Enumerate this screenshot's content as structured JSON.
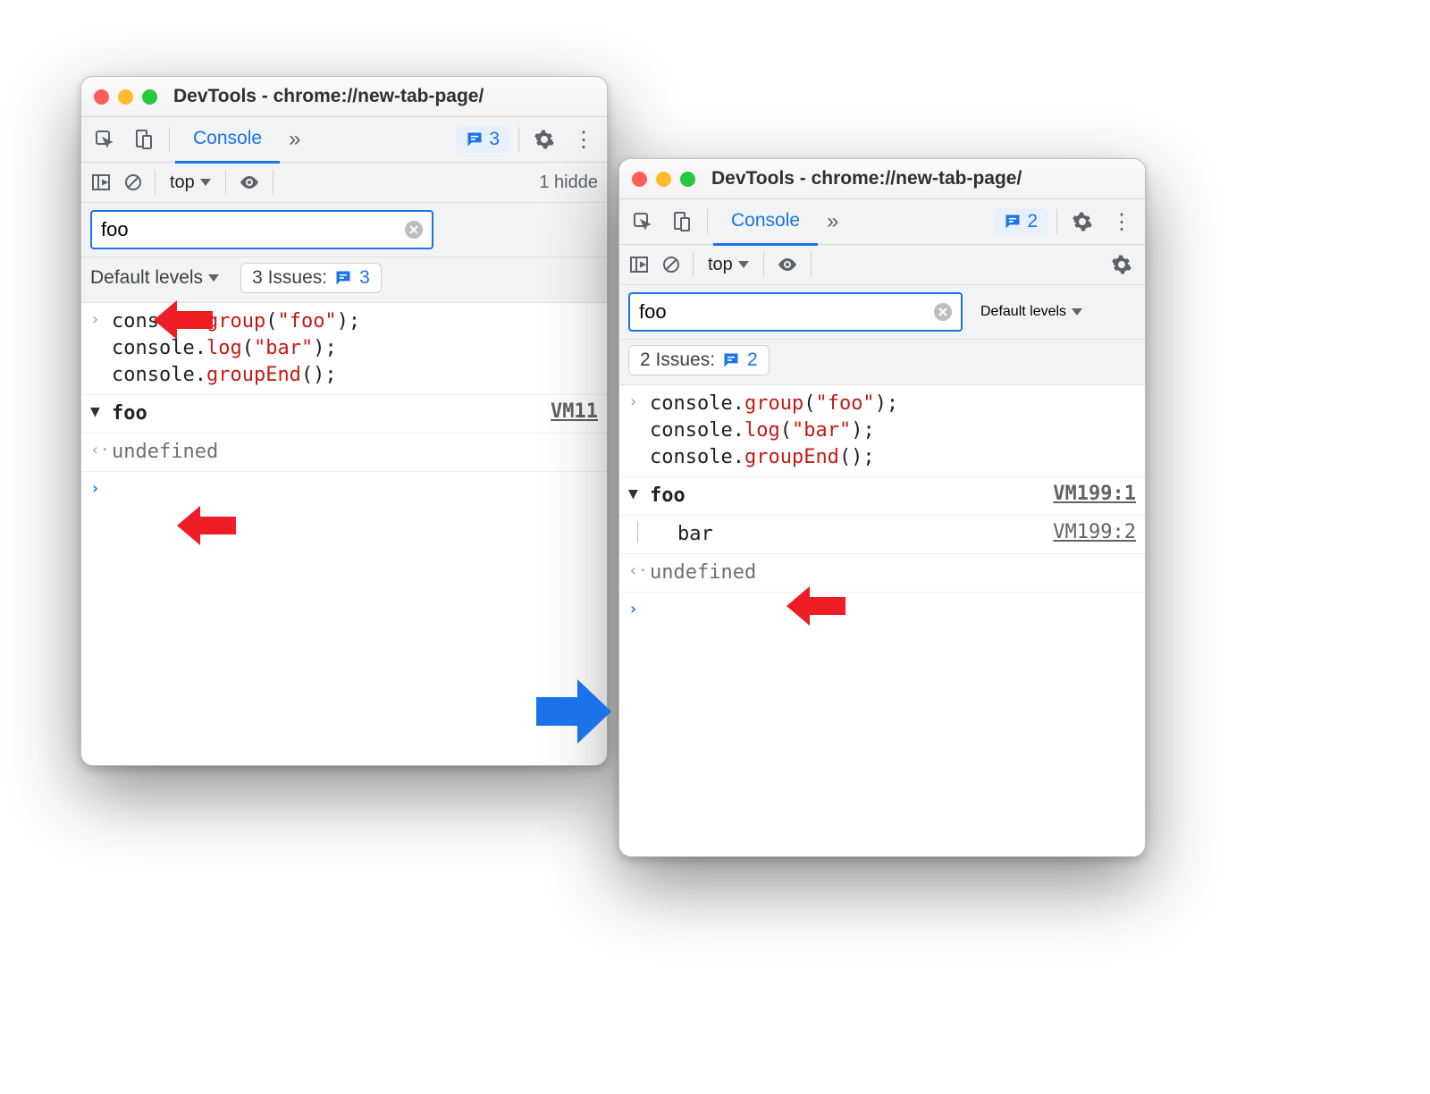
{
  "leftWindow": {
    "title": "DevTools - chrome://new-tab-page/",
    "tab": "Console",
    "issueBadge": "3",
    "context": "top",
    "hidden": "1 hidde",
    "filterValue": "foo",
    "levels": "Default levels",
    "issuesChip": {
      "label": "3 Issues:",
      "count": "3"
    },
    "codeInput": "console.group(\"foo\");\nconsole.log(\"bar\");\nconsole.groupEnd();",
    "groupName": "foo",
    "groupSrc": "VM11",
    "undefined": "undefined"
  },
  "rightWindow": {
    "title": "DevTools - chrome://new-tab-page/",
    "tab": "Console",
    "issueBadge": "2",
    "context": "top",
    "filterValue": "foo",
    "levels": "Default levels",
    "issuesChip": {
      "label": "2 Issues:",
      "count": "2"
    },
    "codeInput": "console.group(\"foo\");\nconsole.log(\"bar\");\nconsole.groupEnd();",
    "groupName": "foo",
    "groupSrc": "VM199:1",
    "barText": "bar",
    "barSrc": "VM199:2",
    "undefined": "undefined"
  }
}
